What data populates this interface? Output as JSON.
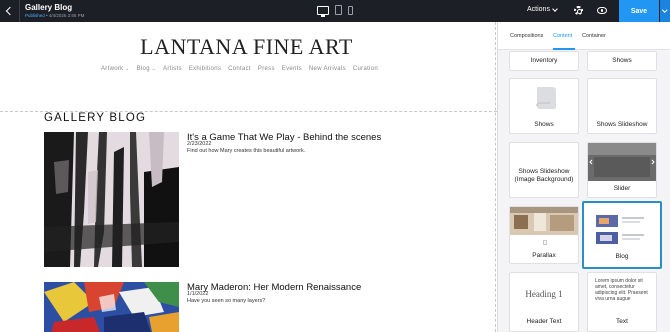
{
  "topbar": {
    "site_title": "Gallery Blog",
    "status_label": "Published",
    "status_date": "• 4/4/2025 2:55 PM",
    "actions_label": "Actions",
    "save_label": "Save",
    "icons": [
      "back-arrow-icon",
      "desktop-icon",
      "tablet-icon",
      "phone-icon",
      "gear-icon",
      "eye-icon",
      "chevron-down-icon"
    ]
  },
  "site": {
    "brand": "LANTANA FINE ART",
    "nav": [
      "Artwork",
      "Blog",
      "Artists",
      "Exhibitions",
      "Contact",
      "Press",
      "Events",
      "New Arrivals",
      "Curation"
    ],
    "blog_heading": "GALLERY BLOG",
    "posts": [
      {
        "title": "It's a Game That We Play - Behind the scenes",
        "date": "2/23/2022",
        "description": "Find out how Mary creates this beautiful artwork."
      },
      {
        "title": "Mary Maderon: Her Modern Renaissance",
        "date": "1/1/2022",
        "description": "Have you seen so many layers?"
      }
    ]
  },
  "panel": {
    "tabs": [
      "Compositions",
      "Content",
      "Container"
    ],
    "active_tab": "Content",
    "tiles": [
      {
        "label": "Inventory"
      },
      {
        "label": "Shows"
      },
      {
        "label": "Shows"
      },
      {
        "label": "Shows Slideshow"
      },
      {
        "label": "Shows Slideshow (Image Background)"
      },
      {
        "label": "Slider"
      },
      {
        "label": "Parallax"
      },
      {
        "label": "Blog"
      },
      {
        "label": "Header Text"
      },
      {
        "label": "Text"
      }
    ],
    "heading_sample": "Heading 1",
    "lorem": "Lorem ipsum dolor sit amet, consectetur adipiscing elit. Praesent viva urna augue"
  },
  "colors": {
    "topbar_bg": "#1c1f26",
    "accent": "#2196f3",
    "selected_border": "#2b8fc7"
  }
}
